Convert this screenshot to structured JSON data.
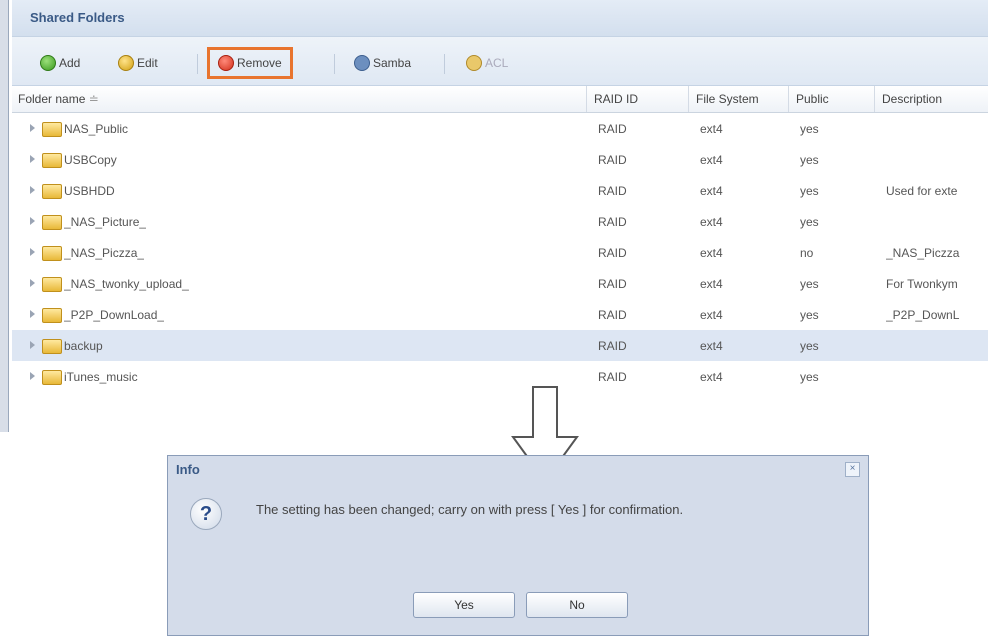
{
  "panel": {
    "title": "Shared Folders"
  },
  "toolbar": {
    "add_label": "Add",
    "edit_label": "Edit",
    "remove_label": "Remove",
    "samba_label": "Samba",
    "acl_label": "ACL"
  },
  "grid": {
    "columns": [
      "Folder name",
      "RAID ID",
      "File System",
      "Public",
      "Description"
    ],
    "sort_indicator": "≐",
    "rows": [
      {
        "name": "NAS_Public",
        "raid": "RAID",
        "fs": "ext4",
        "public": "yes",
        "desc": ""
      },
      {
        "name": "USBCopy",
        "raid": "RAID",
        "fs": "ext4",
        "public": "yes",
        "desc": ""
      },
      {
        "name": "USBHDD",
        "raid": "RAID",
        "fs": "ext4",
        "public": "yes",
        "desc": "Used for exte"
      },
      {
        "name": "_NAS_Picture_",
        "raid": "RAID",
        "fs": "ext4",
        "public": "yes",
        "desc": ""
      },
      {
        "name": "_NAS_Piczza_",
        "raid": "RAID",
        "fs": "ext4",
        "public": "no",
        "desc": "_NAS_Piczza"
      },
      {
        "name": "_NAS_twonky_upload_",
        "raid": "RAID",
        "fs": "ext4",
        "public": "yes",
        "desc": "For Twonkym"
      },
      {
        "name": "_P2P_DownLoad_",
        "raid": "RAID",
        "fs": "ext4",
        "public": "yes",
        "desc": "_P2P_DownL"
      },
      {
        "name": "backup",
        "raid": "RAID",
        "fs": "ext4",
        "public": "yes",
        "desc": "",
        "selected": true
      },
      {
        "name": "iTunes_music",
        "raid": "RAID",
        "fs": "ext4",
        "public": "yes",
        "desc": ""
      }
    ]
  },
  "dialog": {
    "title": "Info",
    "close": "×",
    "icon": "question-icon",
    "message": "The setting has been changed; carry on with press [ Yes ] for confirmation.",
    "yes_label": "Yes",
    "no_label": "No"
  }
}
